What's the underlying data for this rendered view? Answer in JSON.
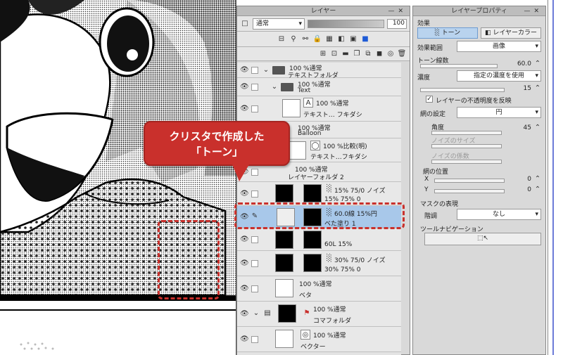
{
  "callout": {
    "line1": "クリスタで作成した",
    "line2": "「トーン」",
    "color": "#c9302c"
  },
  "layer_panel": {
    "title": "レイヤー",
    "blend_mode": "通常",
    "opacity": "100",
    "layers": [
      {
        "l1": "100 %通常",
        "l2": "テキストフォルダ"
      },
      {
        "l1": "100 %通常",
        "l2": "Text"
      },
      {
        "l1": "100 %通常",
        "l2": "テキスト… フキダシ"
      },
      {
        "l1": "100 %通常",
        "l2": "Balloon"
      },
      {
        "l1": "100 %比較(明)",
        "l2": "テキスト…フキダシ"
      },
      {
        "l1": "100 %通常",
        "l2": "レイヤーフォルダ 2"
      },
      {
        "l1": "15% 75/0 ノイズ",
        "l2": "15% 75% 0"
      },
      {
        "l1": "60.0線 15%円",
        "l2": "ベた塗り 1"
      },
      {
        "l1": "60L 15%",
        "l2": ""
      },
      {
        "l1": "30% 75/0 ノイズ",
        "l2": "30% 75% 0"
      },
      {
        "l1": "100 %通常",
        "l2": "ベタ"
      },
      {
        "l1": "100 %通常",
        "l2": "コマフォルダ"
      },
      {
        "l1": "100 %通常",
        "l2": "ベクター"
      }
    ]
  },
  "prop_panel": {
    "title": "レイヤープロパティ",
    "effect_label": "効果",
    "tone_btn": "トーン",
    "layer_color_btn": "レイヤーカラー",
    "effect_range_label": "効果範囲",
    "effect_range_value": "画像",
    "lines_label": "トーン線数",
    "lines_value": "60.0",
    "density_label": "濃度",
    "density_value": "指定の濃度を使用",
    "density_num": "15",
    "reflect_opacity": "レイヤーの不透明度を反映",
    "screen_label": "網の設定",
    "screen_value": "円",
    "angle_label": "角度",
    "angle_value": "45",
    "noise_size_label": "ノイズのサイズ",
    "noise_factor_label": "ノイズの係数",
    "position_label": "網の位置",
    "x_label": "X",
    "x_value": "0",
    "y_label": "Y",
    "y_value": "0",
    "mask_label": "マスクの表現",
    "gradation_label": "階調",
    "gradation_value": "なし",
    "tool_nav_label": "ツールナビゲーション"
  }
}
